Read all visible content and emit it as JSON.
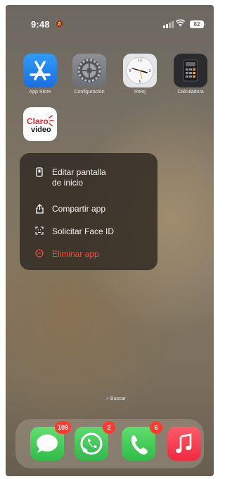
{
  "status_bar": {
    "time": "9:48",
    "battery": "82"
  },
  "apps": [
    {
      "label": "App Store",
      "icon": "app-store-icon"
    },
    {
      "label": "Configuración",
      "icon": "settings-icon"
    },
    {
      "label": "Reloj",
      "icon": "clock-icon"
    },
    {
      "label": "Calculadora",
      "icon": "calculator-icon"
    },
    {
      "label": "",
      "icon": "claro-video-icon",
      "logo_text": "Claro video"
    }
  ],
  "context_menu": {
    "items": [
      {
        "label_line1": "Editar pantalla",
        "label_line2": "de inicio",
        "icon": "phone-edit-icon"
      },
      {
        "label": "Compartir app",
        "icon": "share-icon"
      },
      {
        "label": "Solicitar Face ID",
        "icon": "face-id-icon"
      },
      {
        "label": "Eliminar app",
        "icon": "minus-circle-icon",
        "color": "#ff4a3e"
      }
    ]
  },
  "search": {
    "label": "Buscar"
  },
  "dock": [
    {
      "app": "Mensajes",
      "icon": "messages-icon",
      "badge": "109"
    },
    {
      "app": "WhatsApp",
      "icon": "whatsapp-icon",
      "badge": "2"
    },
    {
      "app": "Teléfono",
      "icon": "phone-icon",
      "badge": "6"
    },
    {
      "app": "Música",
      "icon": "music-icon",
      "badge": ""
    }
  ]
}
